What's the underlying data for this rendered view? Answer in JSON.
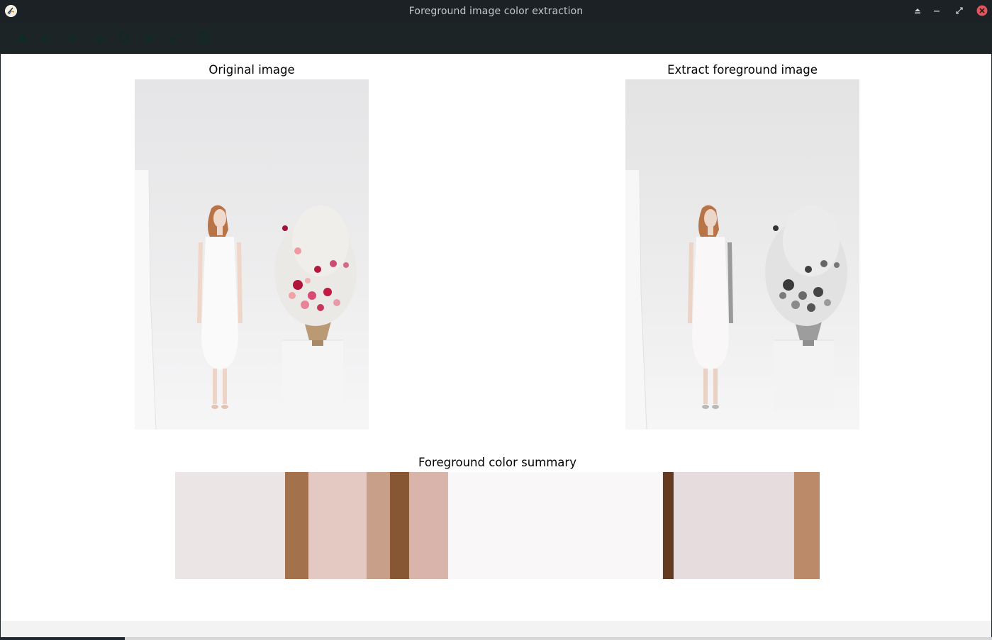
{
  "window": {
    "title": "Foreground image color extraction"
  },
  "toolbar": {
    "buttons": [
      "home-icon",
      "back-icon",
      "forward-icon",
      "pan-icon",
      "zoom-icon",
      "configure-subplots-icon",
      "edit-axes-icon",
      "save-icon"
    ]
  },
  "figure": {
    "original_title": "Original image",
    "extract_title": "Extract foreground image",
    "summary_title": "Foreground color summary"
  },
  "palette": {
    "swatches": [
      {
        "color": "#ebe5e6",
        "fraction": 0.1705
      },
      {
        "color": "#a3714b",
        "fraction": 0.0363
      },
      {
        "color": "#e4c9c2",
        "fraction": 0.0902
      },
      {
        "color": "#c8a08a",
        "fraction": 0.0363
      },
      {
        "color": "#875733",
        "fraction": 0.0297
      },
      {
        "color": "#d8b4aa",
        "fraction": 0.0605
      },
      {
        "color": "#f9f7f8",
        "fraction": 0.3333
      },
      {
        "color": "#643b20",
        "fraction": 0.0165
      },
      {
        "color": "#e6dcdd",
        "fraction": 0.187
      },
      {
        "color": "#bb8b69",
        "fraction": 0.0397
      }
    ]
  }
}
